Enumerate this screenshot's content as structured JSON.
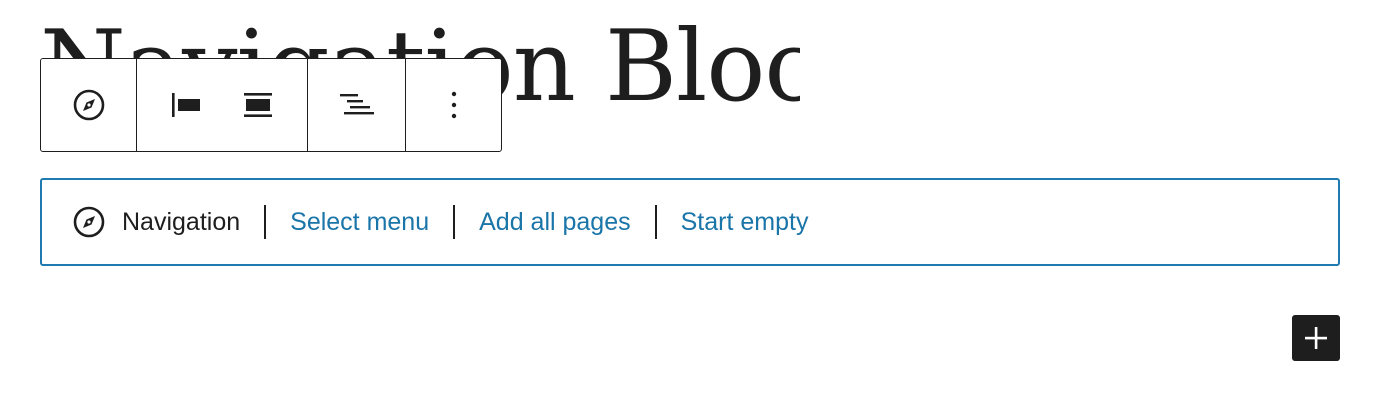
{
  "page": {
    "heading": "Navigation Block"
  },
  "toolbar": {
    "buttons": [
      {
        "name": "block-type",
        "icon": "compass-icon"
      },
      {
        "name": "justify-left",
        "icon": "justify-left-icon"
      },
      {
        "name": "justify-center",
        "icon": "justify-center-icon"
      },
      {
        "name": "item-justification",
        "icon": "justify-right-lines-icon"
      },
      {
        "name": "options",
        "icon": "more-vertical-icon"
      }
    ]
  },
  "placeholder": {
    "icon": "compass-icon",
    "label": "Navigation",
    "actions": {
      "select_menu": "Select menu",
      "add_all_pages": "Add all pages",
      "start_empty": "Start empty"
    }
  },
  "inserter": {
    "icon": "plus-icon"
  },
  "colors": {
    "accent": "#1f7ab2",
    "link": "#1a75a8",
    "text": "#1e1e1e"
  }
}
